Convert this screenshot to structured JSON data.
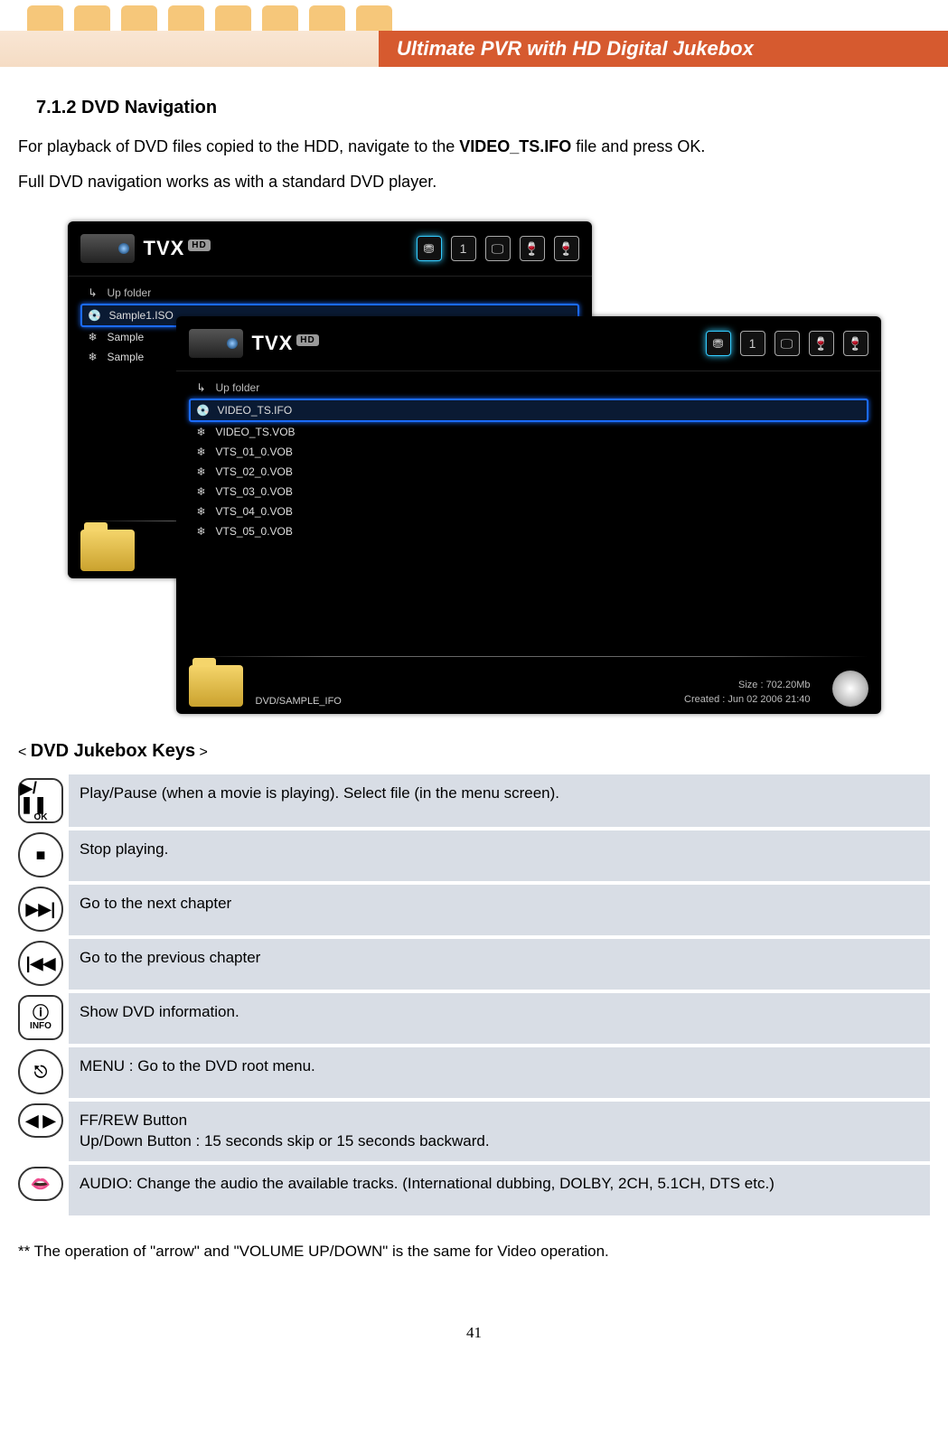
{
  "header": {
    "title": "Ultimate PVR with HD Digital Jukebox"
  },
  "section": {
    "number_title": "7.1.2 DVD Navigation",
    "para1_a": "For playback of DVD files copied to the HDD, navigate to the ",
    "para1_bold": "VIDEO_TS.IFO",
    "para1_b": " file and press OK.",
    "para2": "Full DVD navigation works as with a standard DVD player."
  },
  "figure": {
    "brand": "TVX",
    "brand_badge": "HD",
    "hdd_number": "1",
    "up_label": "Up folder",
    "back_panel": {
      "selected": "Sample1.ISO",
      "rows": [
        "Sample",
        "Sample"
      ]
    },
    "front_panel": {
      "selected": "VIDEO_TS.IFO",
      "rows": [
        "VIDEO_TS.VOB",
        "VTS_01_0.VOB",
        "VTS_02_0.VOB",
        "VTS_03_0.VOB",
        "VTS_04_0.VOB",
        "VTS_05_0.VOB"
      ],
      "path": "DVD/SAMPLE_IFO",
      "size": "Size : 702.20Mb",
      "created": "Created : Jun 02 2006   21:40"
    }
  },
  "keys": {
    "heading": "DVD Jukebox Keys",
    "rows": [
      {
        "icon_top": "▶/❚❚",
        "icon_sub": "OK",
        "desc": "Play/Pause (when a movie is playing). Select file (in the menu screen)."
      },
      {
        "icon_top": "■",
        "icon_sub": "",
        "desc": "Stop playing."
      },
      {
        "icon_top": "▶▶|",
        "icon_sub": "",
        "desc": "Go to the next chapter"
      },
      {
        "icon_top": "|◀◀",
        "icon_sub": "",
        "desc": "Go to the previous chapter"
      },
      {
        "icon_top": "ⓘ",
        "icon_sub": "INFO",
        "desc": "Show DVD information."
      },
      {
        "icon_top": "⎋",
        "icon_sub": "",
        "desc": "MENU : Go to the DVD root menu."
      },
      {
        "icon_top": "◀  ▶",
        "icon_sub": "",
        "desc": "FF/REW Button\nUp/Down Button : 15 seconds skip or 15 seconds backward."
      },
      {
        "icon_top": "👄",
        "icon_sub": "",
        "desc": "AUDIO: Change the audio the available tracks. (International dubbing, DOLBY, 2CH, 5.1CH, DTS etc.)"
      }
    ]
  },
  "footnote": "** The operation of \"arrow\" and \"VOLUME UP/DOWN\" is the same for Video operation.",
  "page_number": "41"
}
